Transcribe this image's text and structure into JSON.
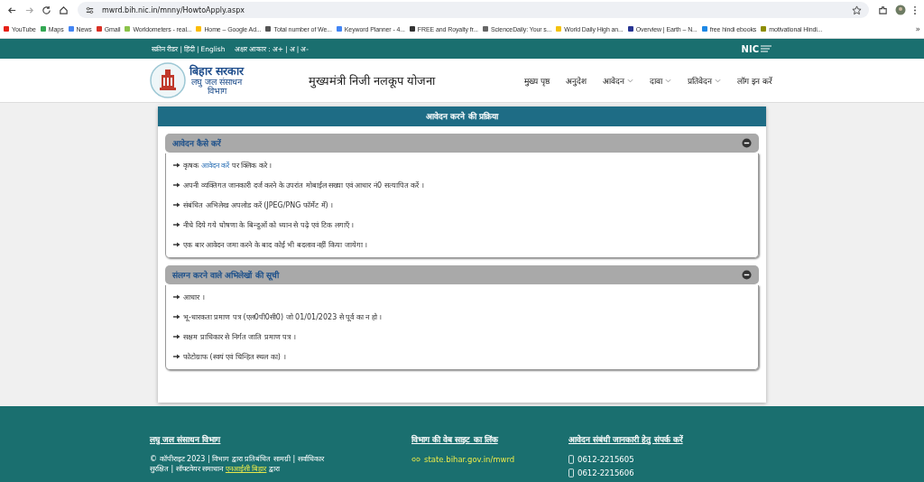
{
  "browser": {
    "url": "mwrd.bih.nic.in/mnny/HowtoApply.aspx",
    "bookmarks": [
      {
        "label": "YouTube",
        "color": "#e62117"
      },
      {
        "label": "Maps",
        "color": "#34a853"
      },
      {
        "label": "News",
        "color": "#4285f4"
      },
      {
        "label": "Gmail",
        "color": "#d93025"
      },
      {
        "label": "Worldometers - real...",
        "color": "#8bc34a"
      },
      {
        "label": "Home – Google Ad...",
        "color": "#fbbc04"
      },
      {
        "label": "Total number of We...",
        "color": "#555555"
      },
      {
        "label": "Keyword Planner - 4...",
        "color": "#4285f4"
      },
      {
        "label": "FREE and Royalty fr...",
        "color": "#333333"
      },
      {
        "label": "ScienceDaily: Your s...",
        "color": "#666666"
      },
      {
        "label": "World Daily High an...",
        "color": "#f4c20d"
      },
      {
        "label": "Overview | Earth – N...",
        "color": "#283593"
      },
      {
        "label": "free hindi ebooks",
        "color": "#1e88e5"
      },
      {
        "label": "motivational Hindi...",
        "color": "#8d8d00"
      }
    ],
    "more": "»"
  },
  "topbar": {
    "separator": "|",
    "links": [
      "स्क्रीन रीडर",
      "हिंदी",
      "English"
    ],
    "font_label": "अक्षर आकार :",
    "font_sizes": [
      "अ+",
      "अ",
      "अ-"
    ],
    "logo": "NIC"
  },
  "header": {
    "org": "बिहार सरकार",
    "dept": "लघु जल संसाधन",
    "dept2": "विभाग",
    "scheme": "मुख्यमंत्री निजी नलकूप योजना",
    "nav": [
      {
        "label": "मुख्य पृष्ठ",
        "dropdown": false
      },
      {
        "label": "अनुदेश",
        "dropdown": false
      },
      {
        "label": "आवेदन",
        "dropdown": true
      },
      {
        "label": "दावा",
        "dropdown": true
      },
      {
        "label": "प्रतिवेदन",
        "dropdown": true
      },
      {
        "label": "लॉग इन करें",
        "dropdown": false
      }
    ]
  },
  "card": {
    "title": "आवेदन करने की प्रक्रिया",
    "sections": [
      {
        "title": "आवेदन कैसे करें",
        "expanded": true,
        "items": [
          {
            "text": "कृषक ",
            "link": "आवेदन करें",
            "after": " पर क्लिक करे ।"
          },
          {
            "text": "अपनी व्यक्तिगत जानकारी दर्ज करने के उपरांत मोबाईल सख्या एवं आधार नं0 सत्यापित करें ।"
          },
          {
            "text": "संबंधित अभिलेख अपलोड करें (JPEG/PNG फॉर्मेट में) ।"
          },
          {
            "text": "नीचे दिये गये घोषणा के बिन्दुओं को ध्यान से पढ़े एवं टिक लगाएँ ।"
          },
          {
            "text": "एक बार आवेदन जमा करने के बाद कोई भी बदलाव नहीं किया जायेगा ।"
          }
        ]
      },
      {
        "title": "संलग्न करने वाले अभिलेखों की सूची",
        "expanded": true,
        "items": [
          {
            "text": "आधार ।"
          },
          {
            "text": "भू-धारकता प्रमाण पत्र (एल0पी0सी0) जो 01/01/2023 से पूर्व का न हो ।"
          },
          {
            "text": "सक्षम प्राधिकार से निर्गत जाति प्रमाण पत्र ।"
          },
          {
            "text": "फोटोग्राफ (स्वयं एवं चिन्हित स्थल का) ।"
          }
        ]
      }
    ]
  },
  "footer": {
    "dept_title": "लघु जल संसाधन विभाग",
    "copyright": "© कॉपीराइट 2023 | विभाग द्वारा प्रतिबंधित सामग्री | सर्वाधिकार सुरक्षित | सॉफ्टवेयर समाधान ",
    "credit_link": "एनआईसी बिहार",
    "credit_after": " द्वारा",
    "web_title": "विभाग की वेब साइट का लिंक",
    "web_link": "state.bihar.gov.in/mwrd",
    "contact_title": "आवेदन संबंधी जानकारी हेतु संपर्क करें",
    "phones": [
      "0612-2215605",
      "0612-2215606"
    ]
  }
}
